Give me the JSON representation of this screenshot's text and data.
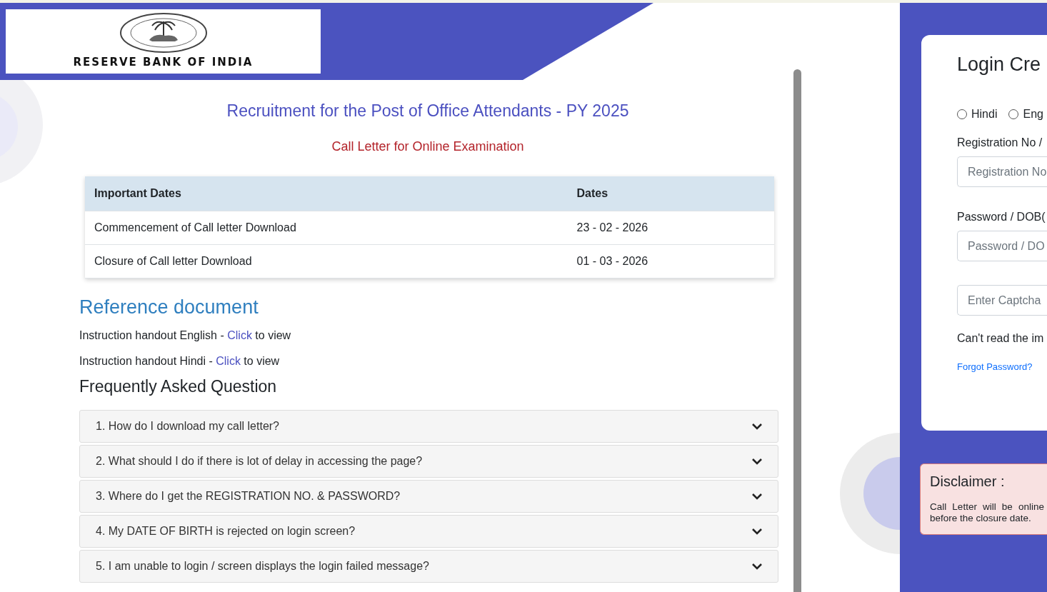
{
  "header": {
    "logo_text": "RESERVE BANK OF INDIA"
  },
  "title": "Recruitment for the Post of Office Attendants - PY 2025",
  "subtitle": "Call Letter for Online Examination",
  "dates_table": {
    "columns": [
      "Important Dates",
      "Dates"
    ],
    "rows": [
      [
        "Commencement of Call letter Download",
        "23 - 02 - 2026"
      ],
      [
        "Closure of Call letter Download",
        "01 - 03 - 2026"
      ]
    ]
  },
  "reference": {
    "heading": "Reference document",
    "items": [
      {
        "label": "Instruction handout English - ",
        "link": "Click",
        "suffix": " to view"
      },
      {
        "label": "Instruction handout Hindi - ",
        "link": "Click",
        "suffix": " to view"
      }
    ]
  },
  "faq": {
    "heading": "Frequently Asked Question",
    "items": [
      {
        "question": "1. How do I download my call letter?",
        "expanded": false
      },
      {
        "question": "2. What should I do if there is lot of delay in accessing the page?",
        "expanded": false
      },
      {
        "question": "3. Where do I get the REGISTRATION NO. & PASSWORD?",
        "expanded": false
      },
      {
        "question": "4. My DATE OF BIRTH is rejected on login screen?",
        "expanded": false
      },
      {
        "question": "5. I am unable to login / screen displays the login failed message?",
        "expanded": false
      }
    ]
  },
  "login": {
    "title": "Login Cre",
    "languages": [
      {
        "label": "Hindi",
        "selected": false
      },
      {
        "label": "Eng",
        "selected": false
      }
    ],
    "fields": [
      {
        "label": "Registration No /",
        "placeholder": "Registration No"
      },
      {
        "label": "Password / DOB(",
        "placeholder": "Password / DO"
      },
      {
        "placeholder": "Enter Captcha"
      }
    ],
    "captcha_hint": "Can't read the im",
    "forgot_link": "Forgot Password?"
  },
  "disclaimer": {
    "title": "Disclaimer :",
    "text": "Call Letter will be online before the closure date."
  }
}
